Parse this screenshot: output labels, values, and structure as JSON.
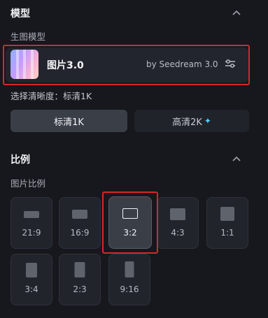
{
  "model_section": {
    "title": "模型",
    "sub_label": "生图模型",
    "model": {
      "name": "图片3.0",
      "by": "by Seedream 3.0"
    }
  },
  "quality": {
    "label": "选择清晰度：标清1K",
    "options": [
      {
        "label": "标清1K",
        "selected": true
      },
      {
        "label": "高清2K",
        "selected": false
      }
    ]
  },
  "ratio_section": {
    "title": "比例",
    "sub_label": "图片比例",
    "ratios": [
      {
        "label": "21:9"
      },
      {
        "label": "16:9"
      },
      {
        "label": "3:2",
        "selected": true
      },
      {
        "label": "4:3"
      },
      {
        "label": "1:1"
      },
      {
        "label": "3:4"
      },
      {
        "label": "2:3"
      },
      {
        "label": "9:16"
      }
    ]
  },
  "colors": {
    "highlight": "#d7262c",
    "sparkle": "#4fd0ff"
  },
  "icons": [
    "chevron-up-icon",
    "sliders-icon",
    "sparkle-icon"
  ]
}
